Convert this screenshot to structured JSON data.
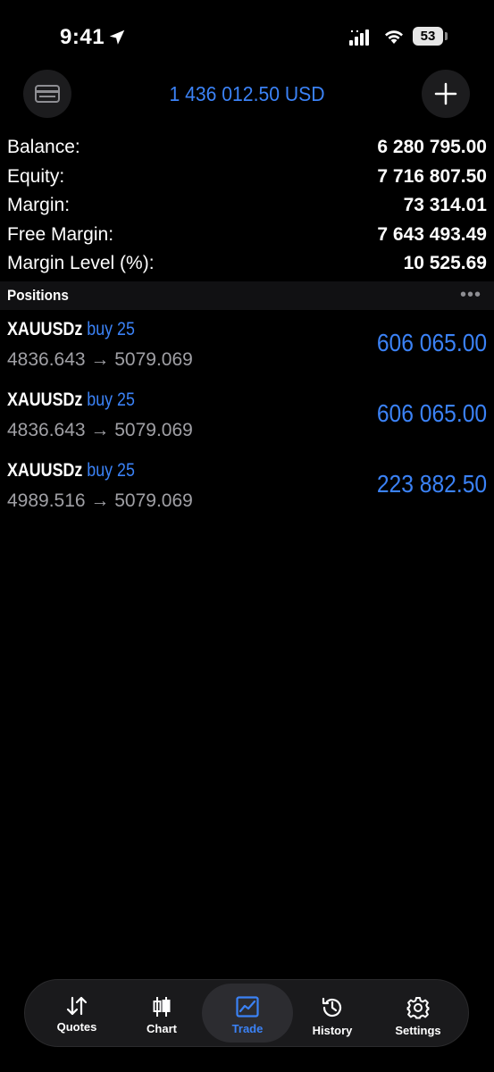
{
  "status": {
    "time": "9:41",
    "battery": "53"
  },
  "header": {
    "title": "1 436 012.50 USD",
    "left_icon": "card-icon",
    "right_icon": "plus-icon"
  },
  "summary": [
    {
      "label": "Balance:",
      "value": "6 280 795.00"
    },
    {
      "label": "Equity:",
      "value": "7 716 807.50"
    },
    {
      "label": "Margin:",
      "value": "73 314.01"
    },
    {
      "label": "Free Margin:",
      "value": "7 643 493.49"
    },
    {
      "label": "Margin Level (%):",
      "value": "10 525.69"
    }
  ],
  "section": {
    "title": "Positions",
    "more": "•••"
  },
  "positions": [
    {
      "symbol": "XAUUSDz",
      "type": "buy 25",
      "prices": "4836.643 → 5079.069",
      "profit": "606 065.00"
    },
    {
      "symbol": "XAUUSDz",
      "type": "buy 25",
      "prices": "4836.643 → 5079.069",
      "profit": "606 065.00"
    },
    {
      "symbol": "XAUUSDz",
      "type": "buy 25",
      "prices": "4989.516 → 5079.069",
      "profit": "223 882.50"
    }
  ],
  "tabs": [
    {
      "label": "Quotes",
      "icon": "sort-arrows-icon"
    },
    {
      "label": "Chart",
      "icon": "candlestick-icon"
    },
    {
      "label": "Trade",
      "icon": "trade-chart-icon",
      "active": true
    },
    {
      "label": "History",
      "icon": "history-clock-icon"
    },
    {
      "label": "Settings",
      "icon": "gear-icon"
    }
  ],
  "colors": {
    "accent": "#3b82f6",
    "background": "#000000",
    "secondary_text": "#a0a0a5"
  }
}
